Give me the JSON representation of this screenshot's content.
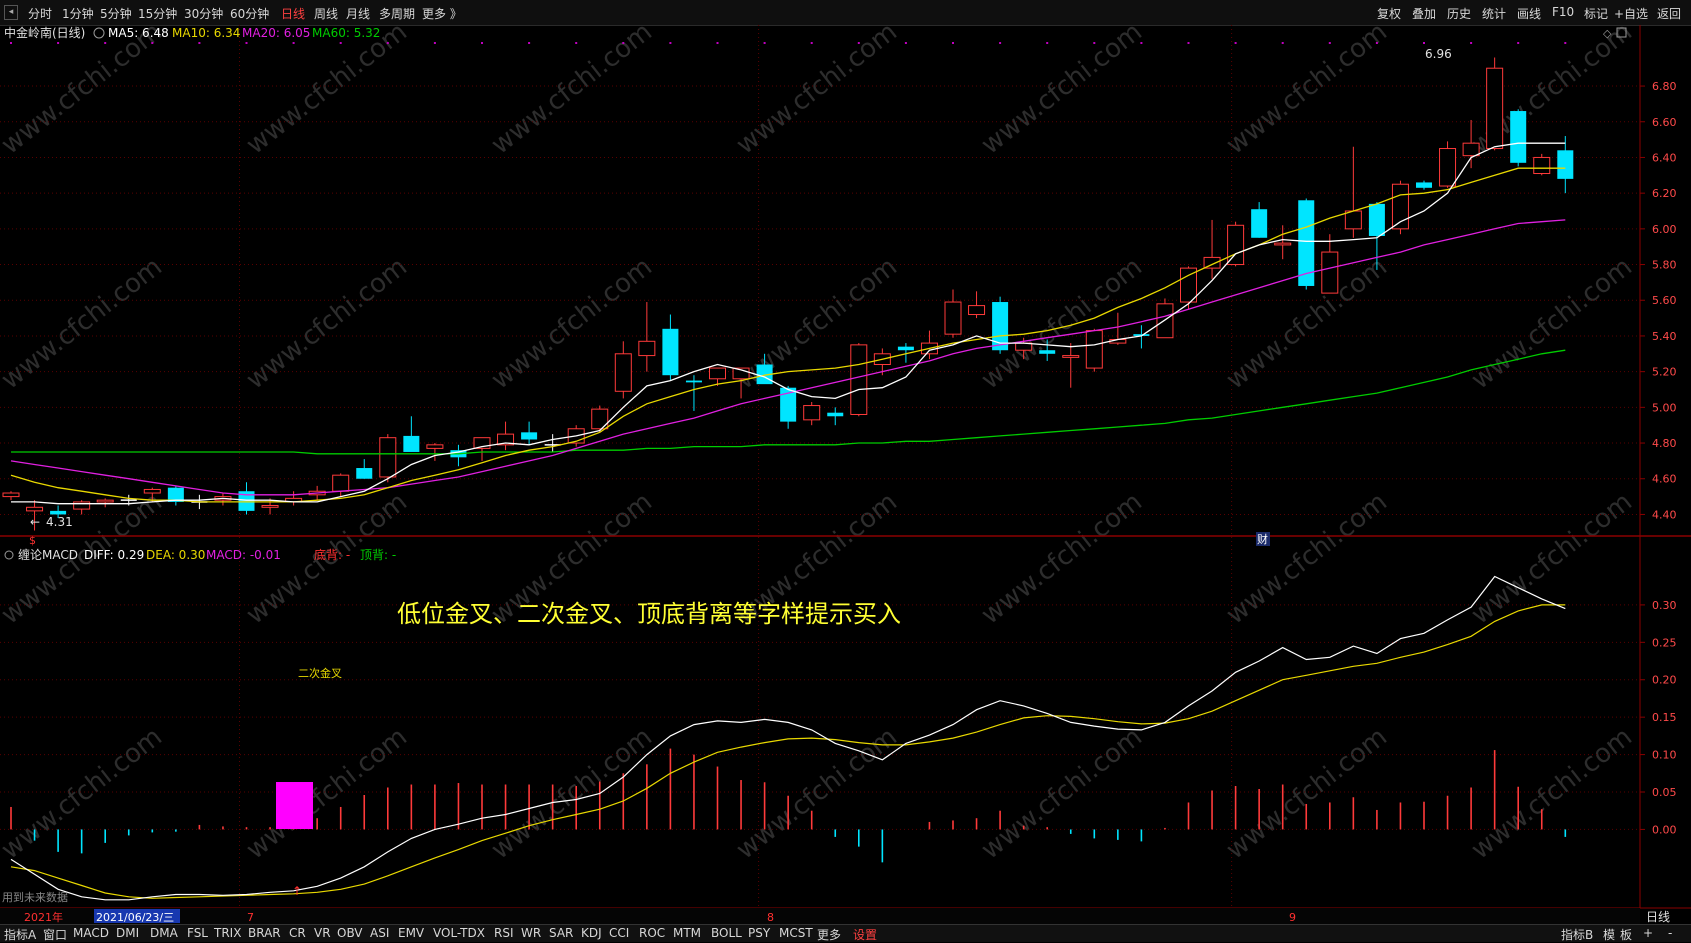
{
  "toolbar": {
    "left": [
      "分时",
      "1分钟",
      "5分钟",
      "15分钟",
      "30分钟",
      "60分钟",
      "日线",
      "周线",
      "月线",
      "多周期",
      "更多 》"
    ],
    "active_index": 6,
    "right": [
      "复权",
      "叠加",
      "历史",
      "统计",
      "画线",
      "F10",
      "标记",
      "+自选",
      "返回"
    ]
  },
  "main_legend": {
    "name": "中金岭南(日线)",
    "ma5": "MA5: 6.48",
    "ma10": "MA10: 6.34",
    "ma20": "MA20: 6.05",
    "ma60": "MA60: 5.32"
  },
  "macd_legend": {
    "name": "缠论MACD",
    "diff": "DIFF: 0.29",
    "dea": "DEA: 0.30",
    "macd": "MACD: -0.01",
    "bottom_div": "底背: -",
    "top_div": "顶背: -"
  },
  "annotation": "低位金叉、二次金叉、顶底背离等字样提示买入",
  "signal_label": "二次金叉",
  "price_high_label": "6.96",
  "price_low_label": "4.31",
  "price_low_marker": "$",
  "cai_marker": "财",
  "future_data_note": "用到未来数据",
  "date_axis": {
    "year_label": "2021年",
    "cursor_date": "2021/06/23/三",
    "month_ticks": [
      "7",
      "8",
      "9"
    ]
  },
  "watermark": "www.cfchi.com",
  "bottom_tabs": [
    "指标A",
    "窗口",
    "MACD",
    "DMI",
    "DMA",
    "FSL",
    "TRIX",
    "BRAR",
    "CR",
    "VR",
    "OBV",
    "ASI",
    "EMV",
    "VOL-TDX",
    "RSI",
    "WR",
    "SAR",
    "KDJ",
    "CCI",
    "ROC",
    "MTM",
    "BOLL",
    "PSY",
    "MCST",
    "更多",
    "设置"
  ],
  "bottom_right": [
    "指标B",
    "模",
    "板",
    "+",
    "-"
  ],
  "period_label": "日线",
  "colors": {
    "up": "#ff3a3a",
    "down": "#00e5ff",
    "ma5": "#ffffff",
    "ma10": "#e8d800",
    "ma20": "#e020e0",
    "ma60": "#00cc00",
    "diff": "#ffffff",
    "dea": "#e8d800",
    "annotation": "#ffff33",
    "grid": "#5a0000"
  },
  "chart_data": [
    {
      "type": "candlestick",
      "title": "中金岭南(日线)",
      "ylim": [
        4.24,
        7.03
      ],
      "yticks": [
        "6.80",
        "6.60",
        "6.40",
        "6.20",
        "6.00",
        "5.80",
        "5.60",
        "5.40",
        "5.20",
        "5.00",
        "4.80",
        "4.60",
        "4.40"
      ],
      "candles": [
        {
          "o": 4.5,
          "h": 4.53,
          "l": 4.48,
          "c": 4.52
        },
        {
          "o": 4.42,
          "h": 4.48,
          "l": 4.31,
          "c": 4.44
        },
        {
          "o": 4.42,
          "h": 4.45,
          "l": 4.38,
          "c": 4.4
        },
        {
          "o": 4.43,
          "h": 4.48,
          "l": 4.4,
          "c": 4.47
        },
        {
          "o": 4.47,
          "h": 4.49,
          "l": 4.44,
          "c": 4.48
        },
        {
          "o": 4.48,
          "h": 4.51,
          "l": 4.45,
          "c": 4.48
        },
        {
          "o": 4.52,
          "h": 4.55,
          "l": 4.47,
          "c": 4.54
        },
        {
          "o": 4.55,
          "h": 4.56,
          "l": 4.45,
          "c": 4.47
        },
        {
          "o": 4.47,
          "h": 4.51,
          "l": 4.43,
          "c": 4.47
        },
        {
          "o": 4.48,
          "h": 4.52,
          "l": 4.45,
          "c": 4.5
        },
        {
          "o": 4.53,
          "h": 4.58,
          "l": 4.4,
          "c": 4.42
        },
        {
          "o": 4.44,
          "h": 4.49,
          "l": 4.4,
          "c": 4.45
        },
        {
          "o": 4.47,
          "h": 4.53,
          "l": 4.45,
          "c": 4.49
        },
        {
          "o": 4.51,
          "h": 4.56,
          "l": 4.48,
          "c": 4.53
        },
        {
          "o": 4.53,
          "h": 4.63,
          "l": 4.5,
          "c": 4.62
        },
        {
          "o": 4.66,
          "h": 4.71,
          "l": 4.6,
          "c": 4.6
        },
        {
          "o": 4.61,
          "h": 4.85,
          "l": 4.58,
          "c": 4.83
        },
        {
          "o": 4.84,
          "h": 4.95,
          "l": 4.78,
          "c": 4.75
        },
        {
          "o": 4.77,
          "h": 4.8,
          "l": 4.7,
          "c": 4.79
        },
        {
          "o": 4.76,
          "h": 4.79,
          "l": 4.67,
          "c": 4.72
        },
        {
          "o": 4.77,
          "h": 4.82,
          "l": 4.7,
          "c": 4.83
        },
        {
          "o": 4.79,
          "h": 4.92,
          "l": 4.76,
          "c": 4.85
        },
        {
          "o": 4.86,
          "h": 4.92,
          "l": 4.79,
          "c": 4.82
        },
        {
          "o": 4.79,
          "h": 4.85,
          "l": 4.75,
          "c": 4.79
        },
        {
          "o": 4.8,
          "h": 4.9,
          "l": 4.78,
          "c": 4.88
        },
        {
          "o": 4.88,
          "h": 5.01,
          "l": 4.86,
          "c": 4.99
        },
        {
          "o": 5.09,
          "h": 5.37,
          "l": 5.05,
          "c": 5.3
        },
        {
          "o": 5.29,
          "h": 5.59,
          "l": 5.2,
          "c": 5.37
        },
        {
          "o": 5.44,
          "h": 5.52,
          "l": 5.15,
          "c": 5.18
        },
        {
          "o": 5.15,
          "h": 5.18,
          "l": 4.98,
          "c": 5.14
        },
        {
          "o": 5.16,
          "h": 5.22,
          "l": 5.12,
          "c": 5.22
        },
        {
          "o": 5.16,
          "h": 5.22,
          "l": 5.05,
          "c": 5.22
        },
        {
          "o": 5.24,
          "h": 5.3,
          "l": 5.14,
          "c": 5.13
        },
        {
          "o": 5.11,
          "h": 5.12,
          "l": 4.88,
          "c": 4.92
        },
        {
          "o": 4.93,
          "h": 5.03,
          "l": 4.9,
          "c": 5.01
        },
        {
          "o": 4.97,
          "h": 5.0,
          "l": 4.9,
          "c": 4.95
        },
        {
          "o": 4.96,
          "h": 5.36,
          "l": 4.95,
          "c": 5.35
        },
        {
          "o": 5.24,
          "h": 5.33,
          "l": 5.18,
          "c": 5.3
        },
        {
          "o": 5.34,
          "h": 5.36,
          "l": 5.25,
          "c": 5.32
        },
        {
          "o": 5.3,
          "h": 5.43,
          "l": 5.27,
          "c": 5.36
        },
        {
          "o": 5.41,
          "h": 5.66,
          "l": 5.39,
          "c": 5.59
        },
        {
          "o": 5.52,
          "h": 5.65,
          "l": 5.5,
          "c": 5.57
        },
        {
          "o": 5.59,
          "h": 5.62,
          "l": 5.3,
          "c": 5.32
        },
        {
          "o": 5.32,
          "h": 5.39,
          "l": 5.27,
          "c": 5.36
        },
        {
          "o": 5.32,
          "h": 5.38,
          "l": 5.26,
          "c": 5.3
        },
        {
          "o": 5.28,
          "h": 5.36,
          "l": 5.11,
          "c": 5.29
        },
        {
          "o": 5.22,
          "h": 5.44,
          "l": 5.2,
          "c": 5.43
        },
        {
          "o": 5.36,
          "h": 5.53,
          "l": 5.35,
          "c": 5.38
        },
        {
          "o": 5.41,
          "h": 5.46,
          "l": 5.33,
          "c": 5.4
        },
        {
          "o": 5.39,
          "h": 5.61,
          "l": 5.39,
          "c": 5.58
        },
        {
          "o": 5.59,
          "h": 5.79,
          "l": 5.55,
          "c": 5.78
        },
        {
          "o": 5.78,
          "h": 6.05,
          "l": 5.72,
          "c": 5.84
        },
        {
          "o": 5.8,
          "h": 6.04,
          "l": 5.79,
          "c": 6.02
        },
        {
          "o": 6.11,
          "h": 6.15,
          "l": 5.95,
          "c": 5.95
        },
        {
          "o": 5.91,
          "h": 6.02,
          "l": 5.83,
          "c": 5.92
        },
        {
          "o": 6.16,
          "h": 6.17,
          "l": 5.66,
          "c": 5.68
        },
        {
          "o": 5.64,
          "h": 5.97,
          "l": 5.64,
          "c": 5.87
        },
        {
          "o": 6.0,
          "h": 6.46,
          "l": 5.95,
          "c": 6.1
        },
        {
          "o": 6.14,
          "h": 6.15,
          "l": 5.77,
          "c": 5.96
        },
        {
          "o": 6.0,
          "h": 6.27,
          "l": 5.97,
          "c": 6.25
        },
        {
          "o": 6.26,
          "h": 6.27,
          "l": 6.22,
          "c": 6.23
        },
        {
          "o": 6.24,
          "h": 6.49,
          "l": 6.23,
          "c": 6.45
        },
        {
          "o": 6.41,
          "h": 6.61,
          "l": 6.34,
          "c": 6.48
        },
        {
          "o": 6.45,
          "h": 6.96,
          "l": 6.44,
          "c": 6.9
        },
        {
          "o": 6.66,
          "h": 6.67,
          "l": 6.35,
          "c": 6.37
        },
        {
          "o": 6.31,
          "h": 6.42,
          "l": 6.3,
          "c": 6.4
        },
        {
          "o": 6.44,
          "h": 6.52,
          "l": 6.2,
          "c": 6.28
        }
      ],
      "ma5": [
        4.47,
        4.47,
        4.46,
        4.46,
        4.46,
        4.46,
        4.47,
        4.48,
        4.48,
        4.49,
        4.48,
        4.48,
        4.47,
        4.47,
        4.5,
        4.53,
        4.6,
        4.68,
        4.73,
        4.75,
        4.78,
        4.8,
        4.79,
        4.82,
        4.84,
        4.87,
        5.0,
        5.12,
        5.15,
        5.2,
        5.24,
        5.21,
        5.17,
        5.1,
        5.06,
        5.05,
        5.1,
        5.11,
        5.17,
        5.32,
        5.35,
        5.4,
        5.36,
        5.36,
        5.35,
        5.34,
        5.35,
        5.38,
        5.4,
        5.49,
        5.58,
        5.71,
        5.86,
        5.91,
        5.94,
        5.93,
        5.93,
        5.94,
        5.95,
        6.04,
        6.1,
        6.2,
        6.4,
        6.46,
        6.48,
        6.48,
        6.48
      ],
      "ma10": [
        4.62,
        4.58,
        4.55,
        4.53,
        4.51,
        4.49,
        4.48,
        4.48,
        4.47,
        4.47,
        4.47,
        4.47,
        4.47,
        4.48,
        4.49,
        4.51,
        4.55,
        4.59,
        4.62,
        4.65,
        4.69,
        4.73,
        4.76,
        4.78,
        4.81,
        4.86,
        4.95,
        5.02,
        5.06,
        5.1,
        5.13,
        5.15,
        5.18,
        5.2,
        5.21,
        5.22,
        5.24,
        5.27,
        5.3,
        5.33,
        5.36,
        5.38,
        5.4,
        5.41,
        5.43,
        5.46,
        5.5,
        5.56,
        5.61,
        5.67,
        5.74,
        5.8,
        5.86,
        5.91,
        5.97,
        6.01,
        6.06,
        6.1,
        6.14,
        6.19,
        6.2,
        6.22,
        6.26,
        6.3,
        6.34,
        6.34,
        6.34
      ],
      "ma20": [
        4.7,
        4.68,
        4.66,
        4.64,
        4.62,
        4.6,
        4.58,
        4.56,
        4.54,
        4.52,
        4.51,
        4.51,
        4.51,
        4.52,
        4.53,
        4.54,
        4.55,
        4.57,
        4.59,
        4.61,
        4.64,
        4.67,
        4.7,
        4.73,
        4.77,
        4.81,
        4.85,
        4.88,
        4.91,
        4.94,
        4.98,
        5.02,
        5.05,
        5.08,
        5.11,
        5.14,
        5.17,
        5.2,
        5.23,
        5.26,
        5.3,
        5.33,
        5.35,
        5.37,
        5.39,
        5.41,
        5.43,
        5.45,
        5.48,
        5.51,
        5.55,
        5.59,
        5.63,
        5.67,
        5.71,
        5.75,
        5.78,
        5.81,
        5.84,
        5.87,
        5.91,
        5.94,
        5.97,
        6.0,
        6.03,
        6.04,
        6.05
      ],
      "ma60": [
        4.75,
        4.75,
        4.75,
        4.75,
        4.75,
        4.75,
        4.75,
        4.75,
        4.75,
        4.75,
        4.75,
        4.75,
        4.75,
        4.74,
        4.74,
        4.74,
        4.74,
        4.74,
        4.74,
        4.74,
        4.75,
        4.75,
        4.75,
        4.75,
        4.76,
        4.76,
        4.76,
        4.77,
        4.77,
        4.78,
        4.78,
        4.78,
        4.79,
        4.79,
        4.79,
        4.79,
        4.8,
        4.8,
        4.81,
        4.81,
        4.82,
        4.83,
        4.84,
        4.85,
        4.86,
        4.87,
        4.88,
        4.89,
        4.9,
        4.91,
        4.93,
        4.94,
        4.96,
        4.98,
        5.0,
        5.02,
        5.04,
        5.06,
        5.08,
        5.11,
        5.14,
        5.17,
        5.21,
        5.24,
        5.27,
        5.3,
        5.32
      ]
    },
    {
      "type": "line",
      "title": "缠论MACD",
      "ylim": [
        -0.105,
        0.36
      ],
      "yticks": [
        "0.30",
        "0.25",
        "0.20",
        "0.15",
        "0.10",
        "0.05",
        "0.00"
      ],
      "series": [
        {
          "name": "DIFF",
          "values": [
            -0.04,
            -0.06,
            -0.08,
            -0.09,
            -0.094,
            -0.094,
            -0.09,
            -0.087,
            -0.087,
            -0.088,
            -0.087,
            -0.084,
            -0.082,
            -0.076,
            -0.065,
            -0.05,
            -0.03,
            -0.012,
            0.0,
            0.007,
            0.015,
            0.02,
            0.028,
            0.036,
            0.04,
            0.048,
            0.07,
            0.1,
            0.125,
            0.14,
            0.145,
            0.143,
            0.147,
            0.143,
            0.133,
            0.115,
            0.105,
            0.093,
            0.115,
            0.126,
            0.14,
            0.16,
            0.172,
            0.165,
            0.155,
            0.143,
            0.138,
            0.134,
            0.133,
            0.143,
            0.165,
            0.185,
            0.21,
            0.225,
            0.243,
            0.227,
            0.23,
            0.245,
            0.235,
            0.255,
            0.262,
            0.28,
            0.297,
            0.338,
            0.323,
            0.308,
            0.295
          ]
        },
        {
          "name": "DEA",
          "values": [
            -0.05,
            -0.055,
            -0.065,
            -0.075,
            -0.085,
            -0.09,
            -0.092,
            -0.091,
            -0.09,
            -0.089,
            -0.088,
            -0.087,
            -0.086,
            -0.084,
            -0.08,
            -0.073,
            -0.062,
            -0.05,
            -0.038,
            -0.027,
            -0.015,
            -0.005,
            0.005,
            0.013,
            0.02,
            0.027,
            0.038,
            0.055,
            0.075,
            0.09,
            0.103,
            0.11,
            0.116,
            0.121,
            0.122,
            0.12,
            0.116,
            0.113,
            0.113,
            0.117,
            0.122,
            0.13,
            0.14,
            0.149,
            0.152,
            0.151,
            0.148,
            0.144,
            0.141,
            0.142,
            0.148,
            0.158,
            0.172,
            0.186,
            0.2,
            0.206,
            0.212,
            0.218,
            0.222,
            0.23,
            0.237,
            0.247,
            0.258,
            0.278,
            0.292,
            0.3,
            0.3
          ]
        },
        {
          "name": "MACD",
          "values": [
            0.03,
            -0.015,
            -0.03,
            -0.032,
            -0.018,
            -0.008,
            -0.004,
            -0.003,
            0.006,
            0.004,
            0.003,
            0.003,
            0.008,
            0.015,
            0.03,
            0.046,
            0.056,
            0.06,
            0.06,
            0.062,
            0.06,
            0.06,
            0.06,
            0.06,
            0.058,
            0.064,
            0.075,
            0.087,
            0.108,
            0.1,
            0.084,
            0.066,
            0.063,
            0.045,
            0.025,
            -0.01,
            -0.023,
            -0.044,
            0.0,
            0.01,
            0.012,
            0.015,
            0.025,
            0.005,
            0.003,
            -0.006,
            -0.012,
            -0.014,
            -0.016,
            0.002,
            0.036,
            0.052,
            0.058,
            0.054,
            0.06,
            0.034,
            0.036,
            0.043,
            0.026,
            0.036,
            0.037,
            0.045,
            0.056,
            0.106,
            0.057,
            0.027,
            -0.01
          ]
        }
      ]
    }
  ]
}
